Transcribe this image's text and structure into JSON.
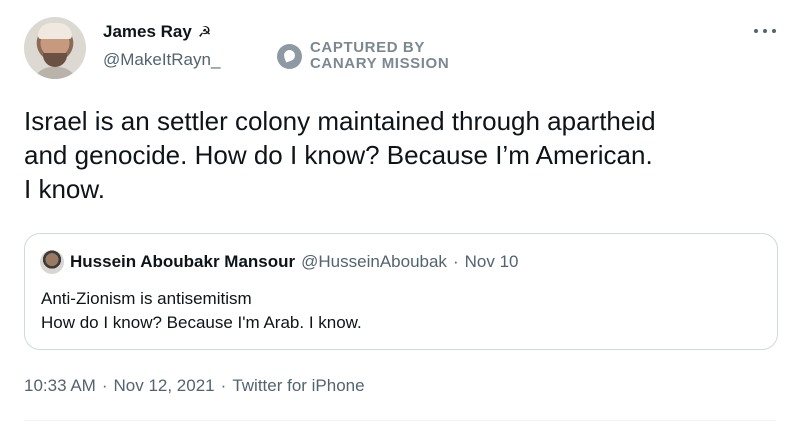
{
  "author": {
    "display_name": "James Ray",
    "name_emoji": "☭",
    "handle": "@MakeItRayn_"
  },
  "watermark": {
    "line1": "CAPTURED BY",
    "line2": "CANARY MISSION"
  },
  "tweet": {
    "text": "Israel is an settler colony maintained through apartheid\nand genocide. How do I know? Because I’m American.\nI know."
  },
  "quote": {
    "display_name": "Hussein Aboubakr Mansour",
    "handle": "@HusseinAboubak",
    "separator": "·",
    "date": "Nov 10",
    "text": "Anti-Zionism is antisemitism\nHow do I know? Because I'm Arab. I know."
  },
  "meta": {
    "time": "10:33 AM",
    "separator": "·",
    "date": "Nov 12, 2021",
    "client": "Twitter for iPhone"
  },
  "colors": {
    "primary_text": "#0f1419",
    "secondary_text": "#536471",
    "border": "#cfd9de"
  }
}
